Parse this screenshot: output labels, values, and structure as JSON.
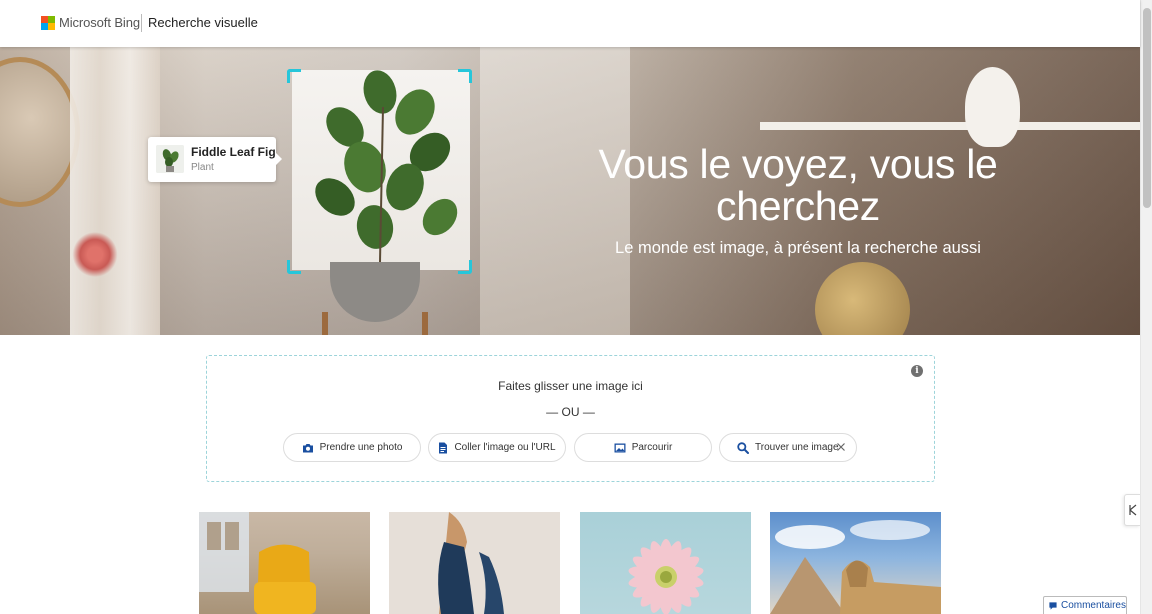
{
  "header": {
    "brand": "Microsoft Bing",
    "section_title": "Recherche visuelle",
    "logo_colors": [
      "#f25022",
      "#7fba00",
      "#00a4ef",
      "#ffb900"
    ]
  },
  "hero": {
    "title": "Vous le voyez, vous le cherchez",
    "subtitle": "Le monde est image, à présent la recherche aussi",
    "tag": {
      "title": "Fiddle Leaf Fig",
      "subtitle": "Plant"
    },
    "accent_color": "#26c6da"
  },
  "dropzone": {
    "drop_text": "Faites glisser une image ici",
    "or_text": "— OU —",
    "info_icon": "info-icon",
    "buttons": [
      {
        "label": "Prendre une photo",
        "icon": "camera-icon"
      },
      {
        "label": "Coller l'image ou l'URL",
        "icon": "document-icon"
      },
      {
        "label": "Parcourir",
        "icon": "image-icon"
      },
      {
        "label": "Trouver une image",
        "icon": "search-icon",
        "close_icon": "close-icon"
      }
    ]
  },
  "examples": [
    {
      "name": "yellow-chair"
    },
    {
      "name": "high-heel-shoe"
    },
    {
      "name": "pink-flower"
    },
    {
      "name": "sphinx-pyramid"
    }
  ],
  "feedback": {
    "label": "Commentaires",
    "icon": "chat-icon",
    "color": "#1a4fa0"
  }
}
